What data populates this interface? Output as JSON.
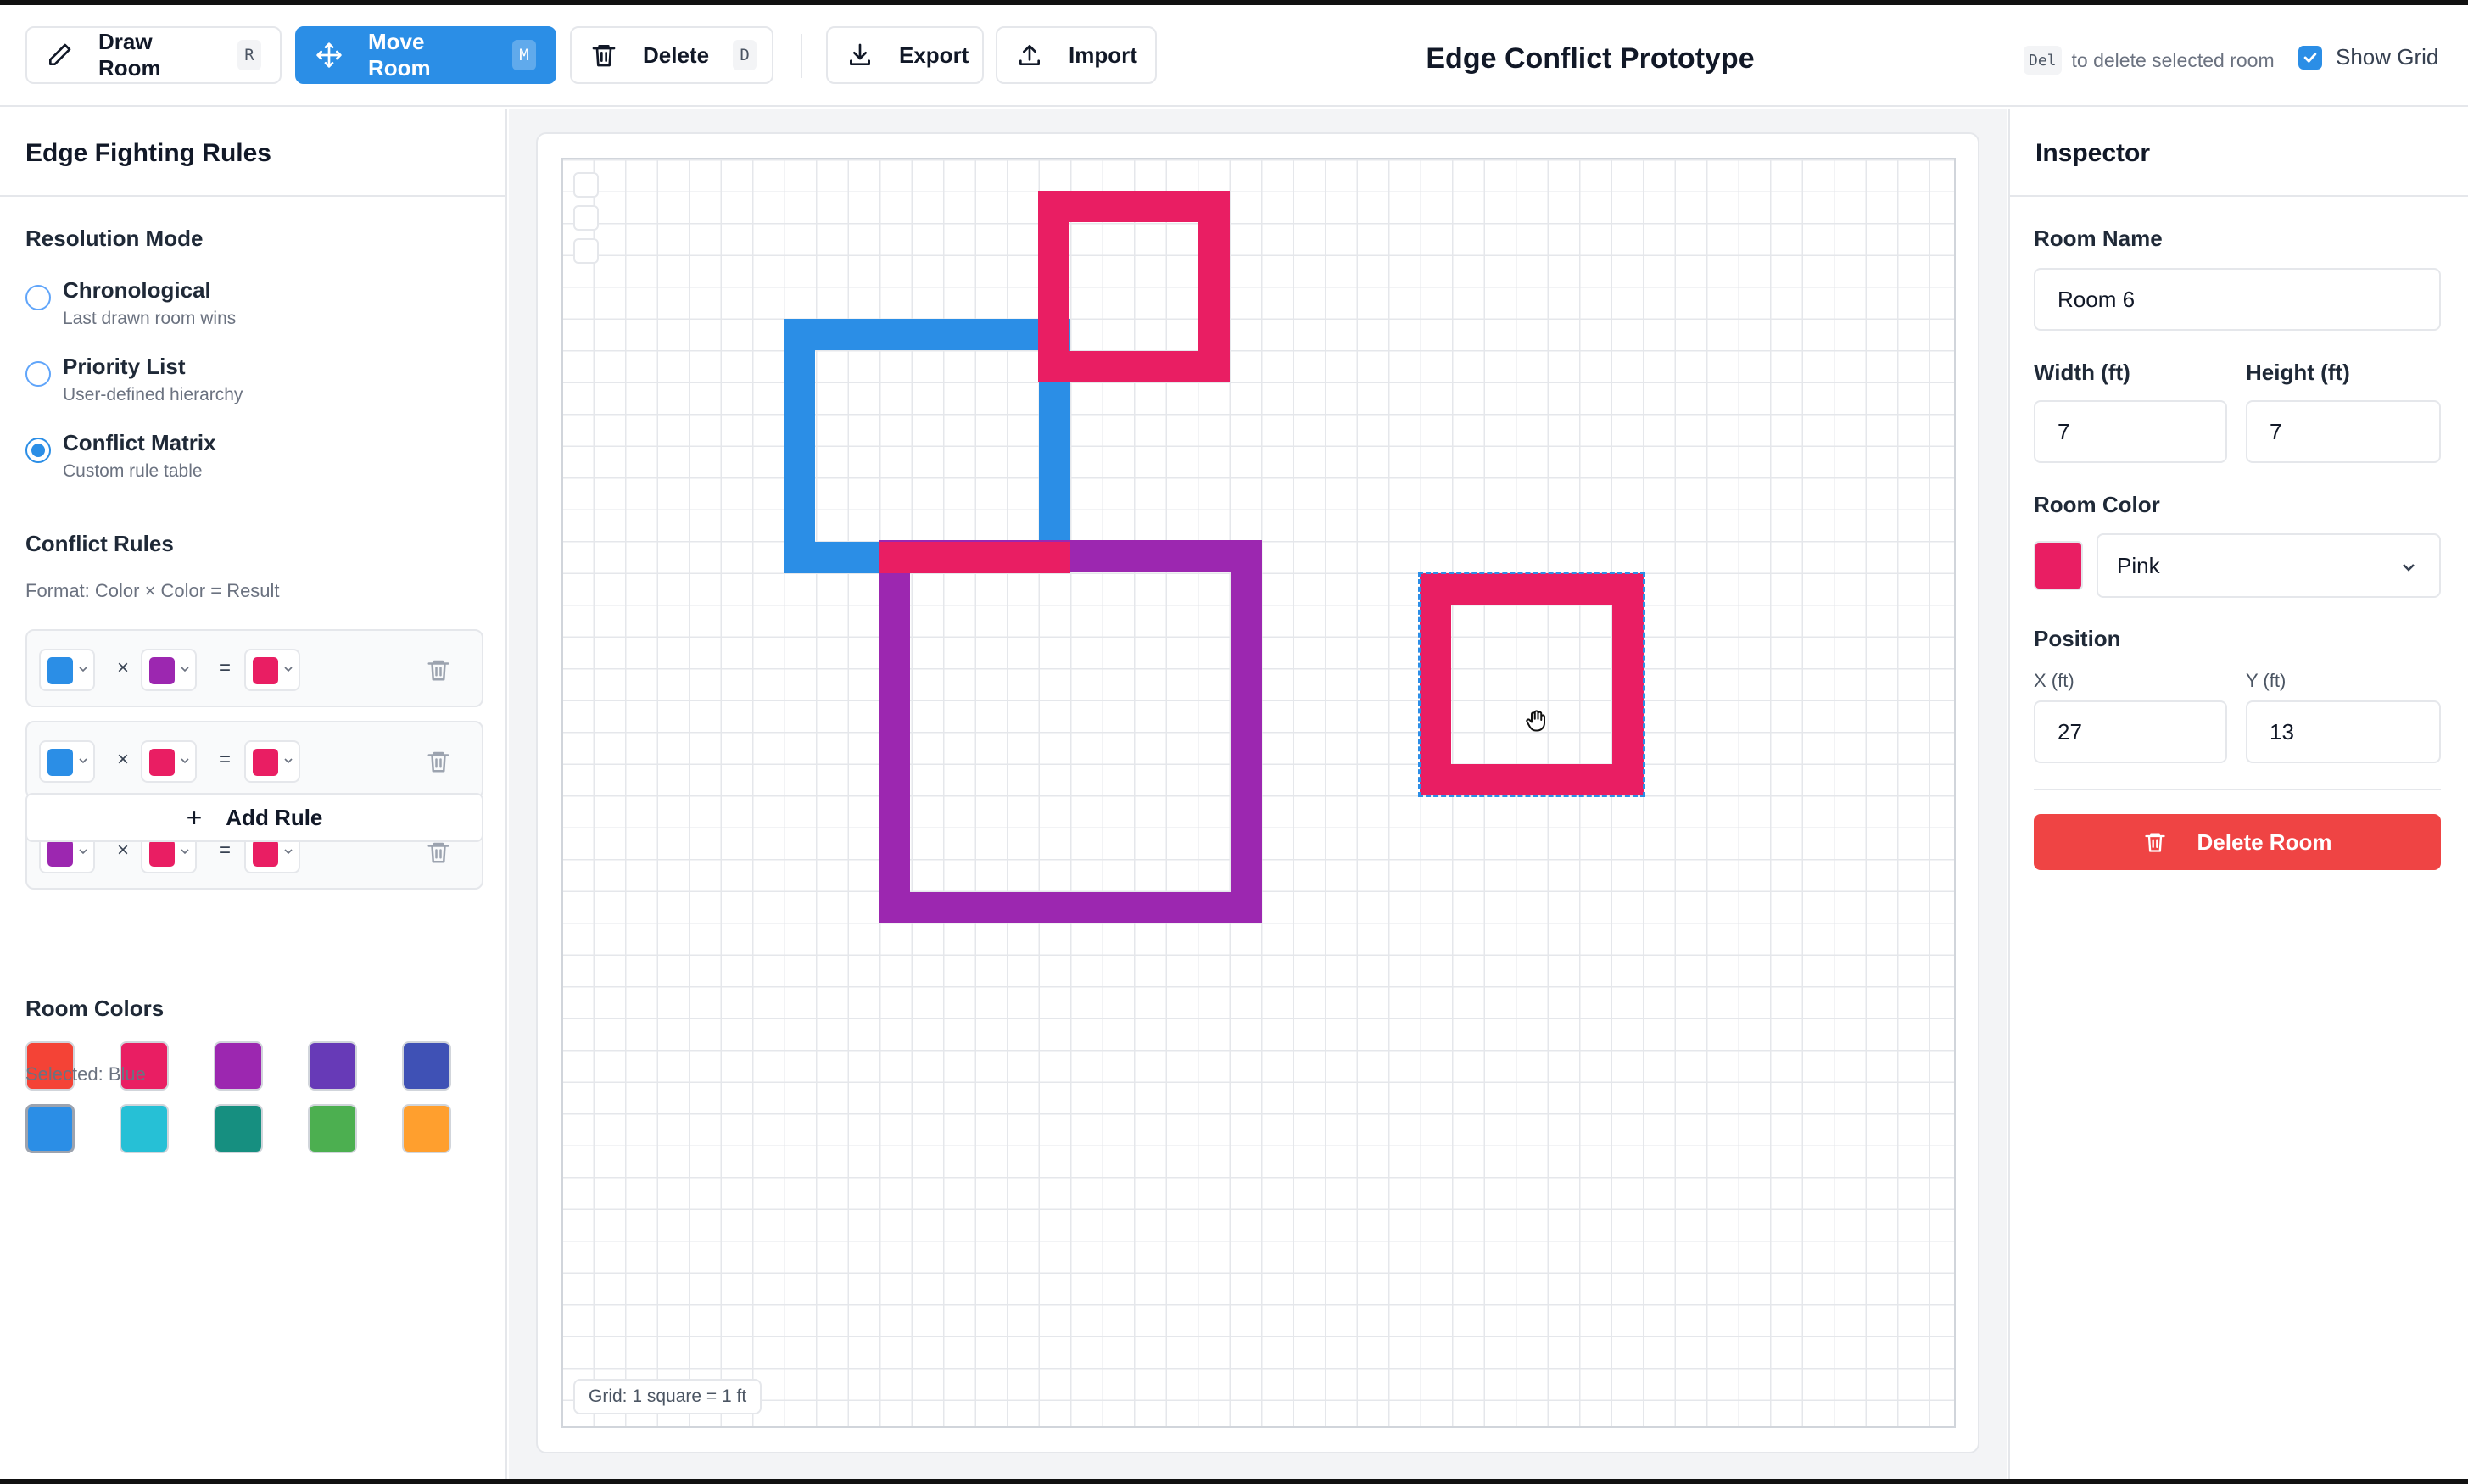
{
  "toolbar": {
    "draw_room": {
      "label": "Draw Room",
      "key": "R"
    },
    "move_room": {
      "label": "Move Room",
      "key": "M"
    },
    "delete": {
      "label": "Delete",
      "key": "D"
    },
    "export": {
      "label": "Export"
    },
    "import": {
      "label": "Import"
    },
    "title": "Edge Conflict Prototype",
    "hint_key": "Del",
    "hint_text": "to delete selected room",
    "show_grid_label": "Show Grid",
    "show_grid_checked": true
  },
  "left_panel": {
    "title": "Edge Fighting Rules",
    "resolution_title": "Resolution Mode",
    "modes": [
      {
        "label": "Chronological",
        "desc": "Last drawn room wins",
        "checked": false
      },
      {
        "label": "Priority List",
        "desc": "User-defined hierarchy",
        "checked": false
      },
      {
        "label": "Conflict Matrix",
        "desc": "Custom rule table",
        "checked": true
      }
    ],
    "conflict_title": "Conflict Rules",
    "format_text": "Format: Color × Color = Result",
    "times_symbol": "×",
    "equals_symbol": "=",
    "rules": [
      {
        "a": "#2b8ee6",
        "b": "#9c27b0",
        "result": "#e91e63"
      },
      {
        "a": "#2b8ee6",
        "b": "#e91e63",
        "result": "#e91e63"
      },
      {
        "a": "#9c27b0",
        "b": "#e91e63",
        "result": "#e91e63"
      }
    ],
    "add_rule_label": "Add Rule",
    "room_colors_title": "Room Colors",
    "palette": [
      "#f44336",
      "#e91e63",
      "#9c27b0",
      "#673ab7",
      "#3f51b5",
      "#2b8ee6",
      "#26c0d6",
      "#168f80",
      "#4caf50",
      "#ff9f2e"
    ],
    "selected_index": 5,
    "selected_text": "Selected: Blue"
  },
  "canvas": {
    "grid_label": "Grid: 1 square = 1 ft",
    "colors": {
      "blue": "#2b8ee6",
      "pink": "#e91e63",
      "purple": "#9c27b0"
    }
  },
  "inspector": {
    "title": "Inspector",
    "room_name_label": "Room Name",
    "room_name": "Room 6",
    "width_label": "Width (ft)",
    "width": "7",
    "height_label": "Height (ft)",
    "height": "7",
    "room_color_label": "Room Color",
    "room_color": "#e91e63",
    "room_color_name": "Pink",
    "position_label": "Position",
    "x_label": "X (ft)",
    "x": "27",
    "y_label": "Y (ft)",
    "y": "13",
    "delete_label": "Delete Room"
  }
}
